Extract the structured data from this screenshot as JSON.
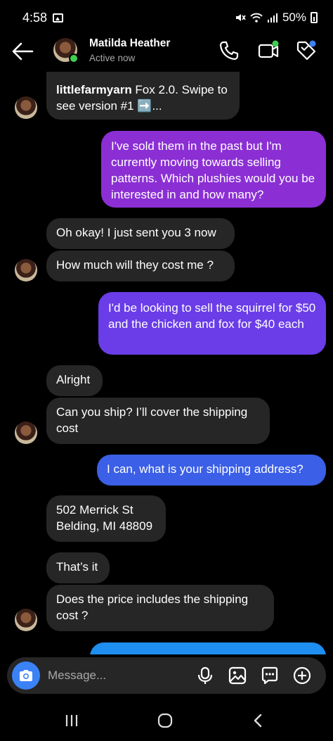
{
  "status_bar": {
    "time": "4:58",
    "battery": "50%"
  },
  "header": {
    "name": "Matilda Heather",
    "status": "Active now"
  },
  "messages": [
    {
      "sender": "them",
      "username": "littlefarmyarn",
      "text": " Fox 2.0. Swipe to see version #1 ➡️..."
    },
    {
      "sender": "me",
      "text": "I've sold them in the past but I'm currently moving towards selling patterns. Which plushies would you be interested in and how many?"
    },
    {
      "sender": "them",
      "text": "Oh okay! I just sent you 3 now"
    },
    {
      "sender": "them",
      "text": "How much will they cost me ?"
    },
    {
      "sender": "me",
      "text": "I'd be looking to sell the squirrel for $50 and the chicken and fox for $40 each"
    },
    {
      "sender": "them",
      "text": "Alright"
    },
    {
      "sender": "them",
      "text": "Can you ship? I’ll cover the shipping cost"
    },
    {
      "sender": "me",
      "text": "I can, what is your shipping address?"
    },
    {
      "sender": "them",
      "text": "502 Merrick St Belding, MI 48809"
    },
    {
      "sender": "them",
      "text": "That’s it"
    },
    {
      "sender": "them",
      "text": "Does the price includes the shipping cost ?"
    }
  ],
  "composer": {
    "placeholder": "Message..."
  },
  "colors": {
    "outgoing_purple": "#8b2fd4",
    "outgoing_violet": "#6a3de8",
    "outgoing_blue": "#3b5fe6",
    "incoming": "#262626",
    "online": "#3fcf4f",
    "camera": "#3b82f6"
  }
}
